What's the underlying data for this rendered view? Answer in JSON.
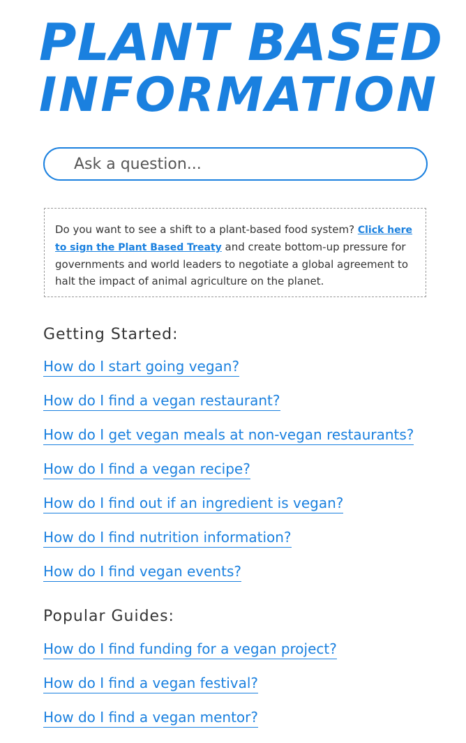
{
  "logo": {
    "line1": "PLANT BASED",
    "line2": "INFORMATION"
  },
  "search": {
    "placeholder": "Ask a question..."
  },
  "notice": {
    "text_before": "Do you want to see a shift to a plant-based food system? ",
    "link": "Click here to sign the Plant Based Treaty",
    "text_after": " and create bottom-up pressure for governments and world leaders to negotiate a global agreement to halt the impact of animal agriculture on the planet."
  },
  "getting_started": {
    "heading": "Getting Started:",
    "items": [
      "How do I start going vegan?",
      "How do I find a vegan restaurant?",
      "How do I get vegan meals at non-vegan restaurants?",
      "How do I find a vegan recipe?",
      "How do I find out if an ingredient is vegan?",
      "How do I find nutrition information?",
      "How do I find vegan events?"
    ]
  },
  "popular_guides": {
    "heading": "Popular Guides:",
    "items": [
      "How do I find funding for a vegan project?",
      "How do I find a vegan festival?",
      "How do I find a vegan mentor?"
    ]
  },
  "colors": {
    "accent": "#1a80df",
    "text": "#333333",
    "border": "#999999"
  }
}
